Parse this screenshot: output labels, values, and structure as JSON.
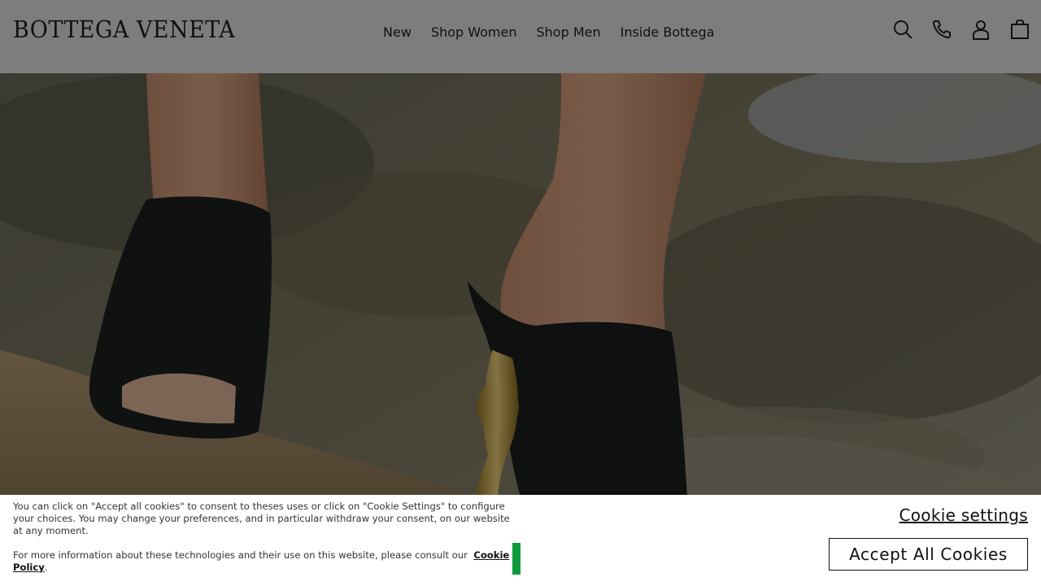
{
  "brand": {
    "logo_text": "BOTTEGA VENETA"
  },
  "nav": {
    "items": [
      {
        "label": "New"
      },
      {
        "label": "Shop Women"
      },
      {
        "label": "Shop Men"
      },
      {
        "label": "Inside Bottega"
      }
    ]
  },
  "header_icons": [
    "search-icon",
    "phone-icon",
    "account-icon",
    "bag-icon"
  ],
  "hero": {
    "image_alt": ""
  },
  "cookie_banner": {
    "intro_text": "You can click on \"Accept all cookies\" to consent to theses uses or click on \"Cookie Settings\" to configure your choices. You may change your preferences, and in particular withdraw your consent, on our website at any moment.",
    "more_info_text": "For more information about these technologies and their use on this website, please consult our",
    "policy_link": "Cookie Policy",
    "policy_suffix": ".",
    "settings_label": "Cookie settings",
    "accept_label": "Accept All Cookies"
  },
  "colors": {
    "header_bg": "#7d7d7d",
    "text": "#111111",
    "banner_bg": "#ffffff",
    "accent_green": "#0f9a3c"
  }
}
